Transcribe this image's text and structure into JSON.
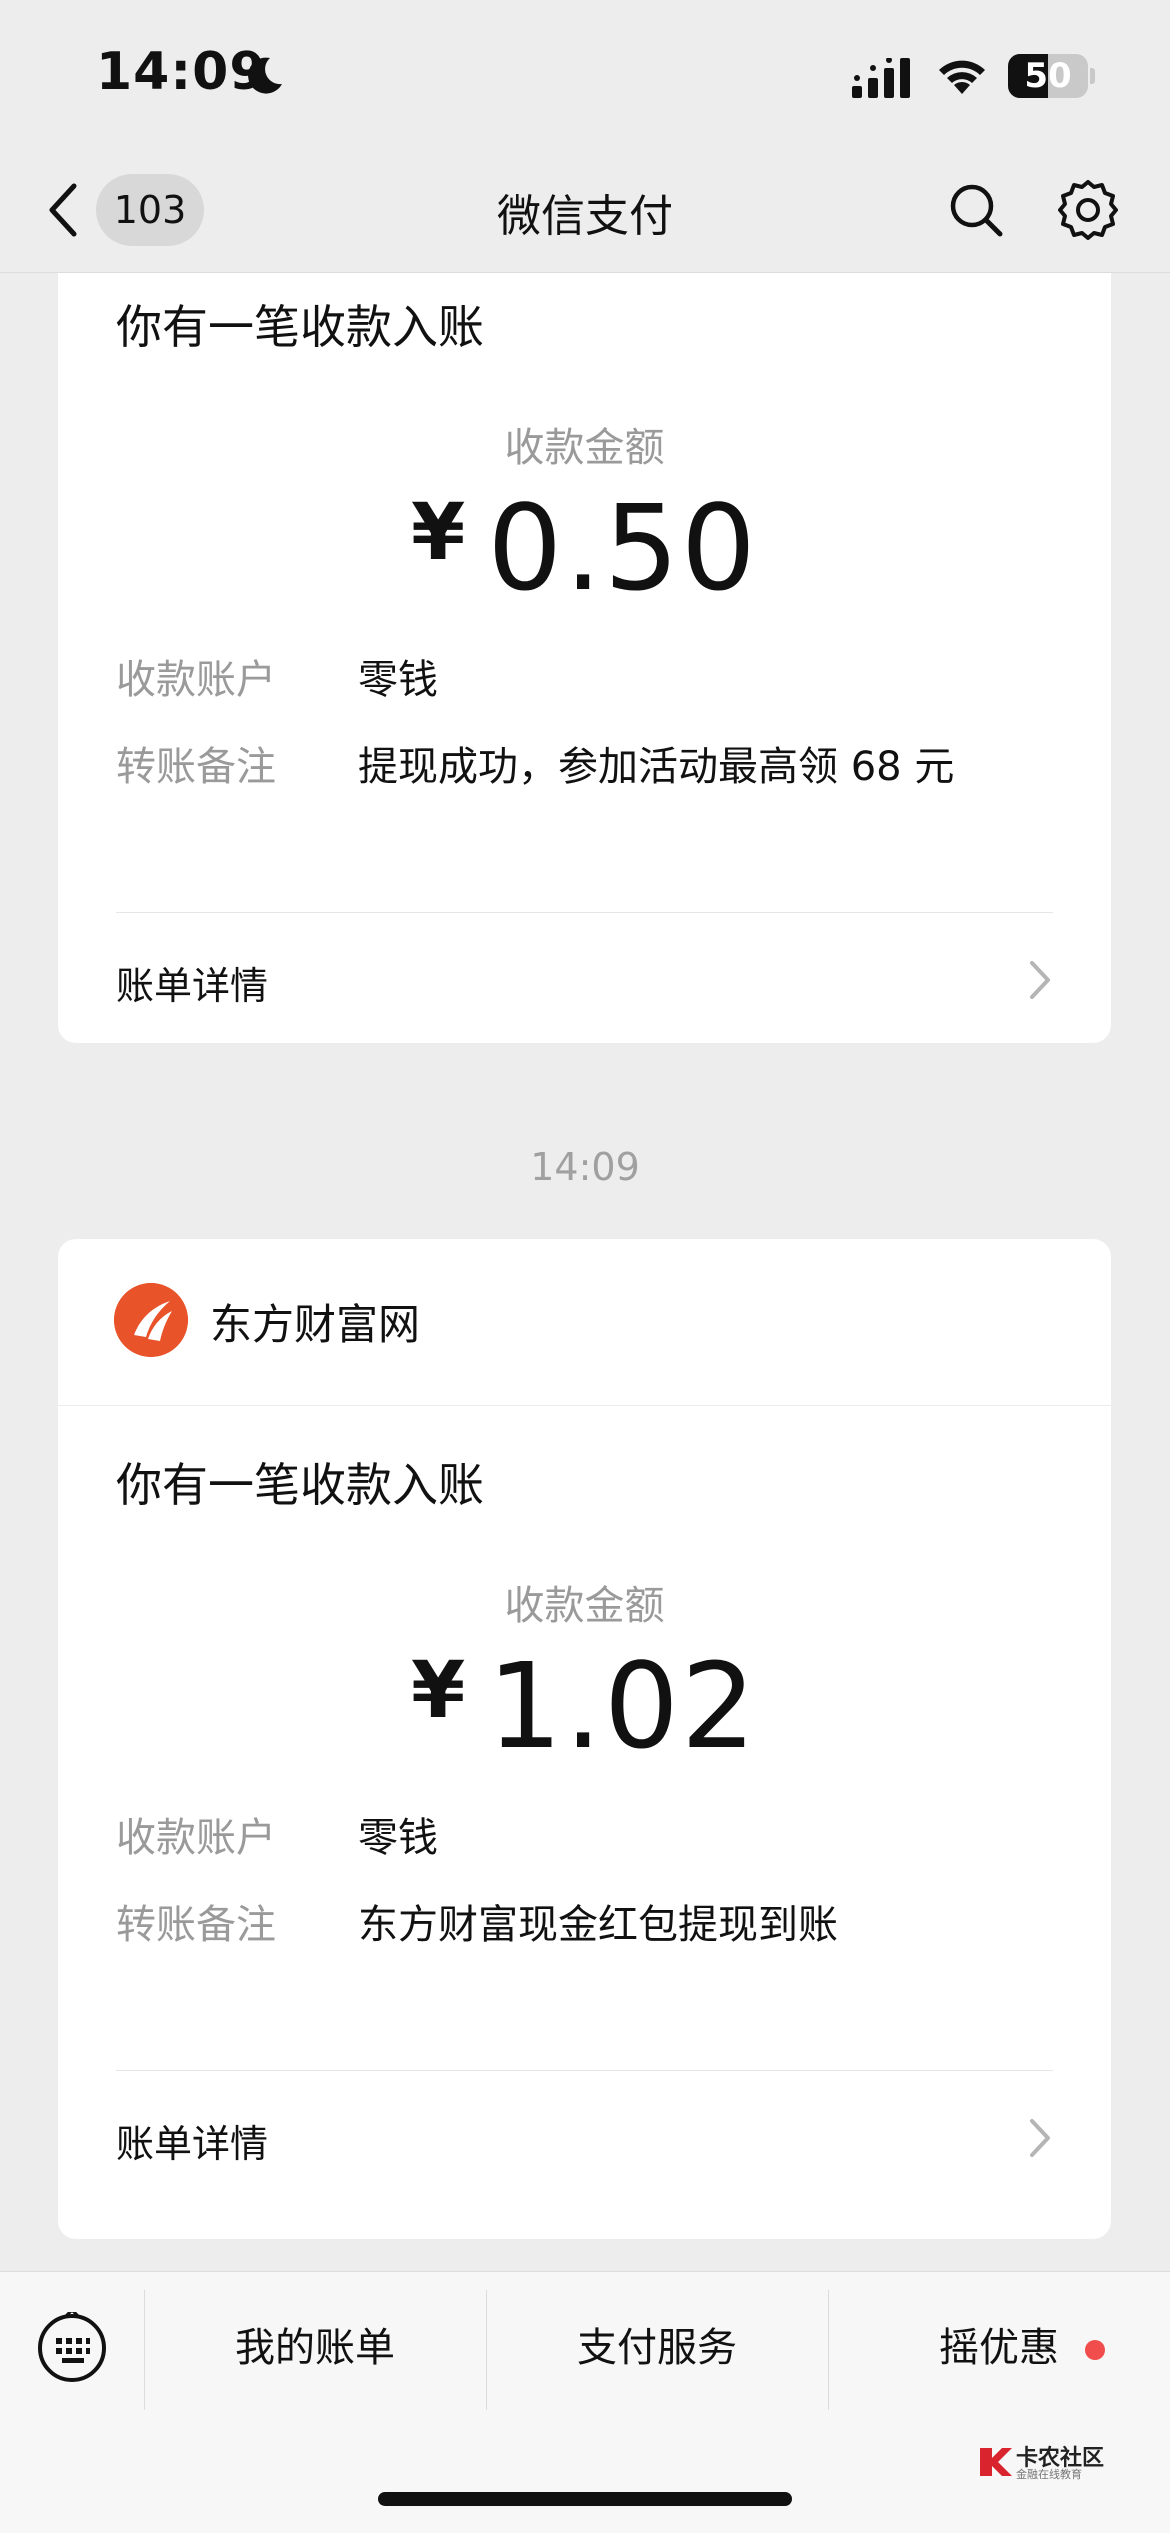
{
  "status_bar": {
    "time": "14:09",
    "battery": "50",
    "battery_level": 0.5
  },
  "nav": {
    "back_badge": "103",
    "title": "微信支付"
  },
  "cards": [
    {
      "heading": "你有一笔收款入账",
      "amount_label": "收款金额",
      "currency": "¥",
      "amount": "0.50",
      "account_label": "收款账户",
      "account_value": "零钱",
      "note_label": "转账备注",
      "note_value": "提现成功，参加活动最高领 68 元",
      "detail_link": "账单详情"
    },
    {
      "merchant": "东方财富网",
      "heading": "你有一笔收款入账",
      "amount_label": "收款金额",
      "currency": "¥",
      "amount": "1.02",
      "account_label": "收款账户",
      "account_value": "零钱",
      "note_label": "转账备注",
      "note_value": "东方财富现金红包提现到账",
      "detail_link": "账单详情"
    }
  ],
  "timestamp": "14:09",
  "bottom_bar": {
    "tabs": [
      "我的账单",
      "支付服务",
      "摇优惠"
    ]
  },
  "watermark": {
    "title": "卡农社区",
    "subtitle": "金融在线教育"
  },
  "colors": {
    "background": "#EDEDED",
    "card": "#FFFFFF",
    "merchant_logo": "#E8532A",
    "notification_dot": "#F24D4D"
  },
  "icons": [
    "moon-icon",
    "signal-icon",
    "wifi-icon",
    "battery-icon",
    "back-icon",
    "search-icon",
    "settings-icon",
    "chevron-right-icon",
    "keyboard-icon"
  ]
}
